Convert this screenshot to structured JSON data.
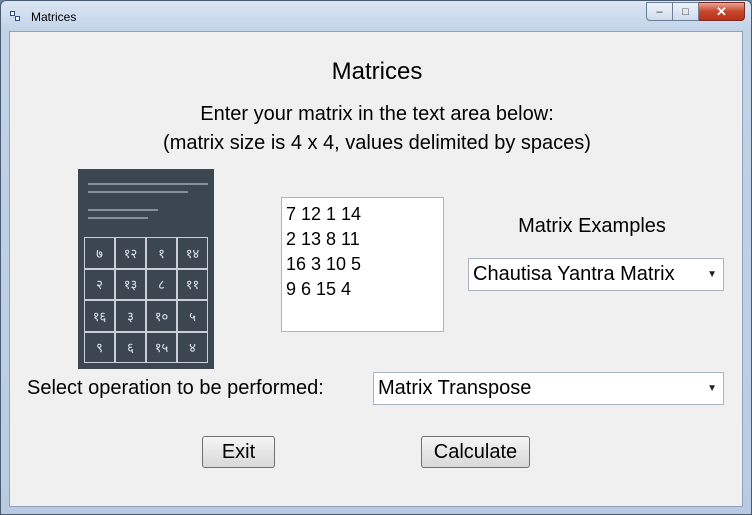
{
  "window": {
    "title": "Matrices",
    "controls": {
      "minimize": "–",
      "maximize": "□",
      "close": "✕"
    }
  },
  "header": {
    "title": "Matrices",
    "instruction_line1": "Enter your matrix in the text area below:",
    "instruction_line2": "(matrix size is 4 x 4, values delimited by spaces)"
  },
  "yantra_image": {
    "cells": [
      "७",
      "१२",
      "१",
      "१४",
      "२",
      "१३",
      "८",
      "११",
      "१६",
      "३",
      "१०",
      "५",
      "९",
      "६",
      "१५",
      "४"
    ]
  },
  "matrix_input": {
    "rows": [
      "7 12 1 14",
      "2 13 8 11",
      "16 3 10 5",
      "9 6 15 4"
    ]
  },
  "examples": {
    "label": "Matrix Examples",
    "selected": "Chautisa Yantra Matrix"
  },
  "operation": {
    "label": "Select operation to be performed:",
    "selected": "Matrix Transpose"
  },
  "buttons": {
    "exit": "Exit",
    "calculate": "Calculate"
  },
  "colors": {
    "client_background": "#f0f0f0",
    "close_button": "#c8452c"
  }
}
